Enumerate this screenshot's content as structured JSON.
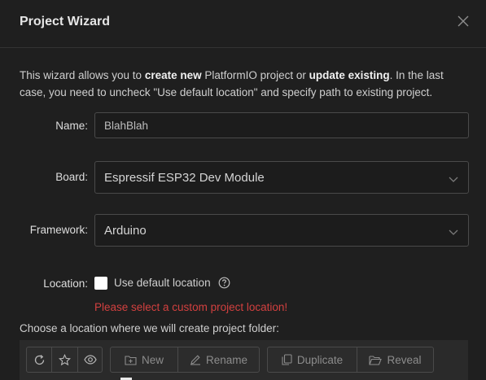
{
  "dialog": {
    "title": "Project Wizard",
    "intro": {
      "t1": "This wizard allows you to ",
      "b1": "create new",
      "t2": " PlatformIO project or ",
      "b2": "update existing",
      "t3": ". In the last case, you need to uncheck \"Use default location\" and specify path to existing project."
    }
  },
  "form": {
    "name_label": "Name",
    "name_value": "BlahBlah",
    "board_label": "Board",
    "board_value": "Espressif ESP32 Dev Module",
    "framework_label": "Framework",
    "framework_value": "Arduino",
    "location_label": "Location",
    "default_location_label": "Use default location",
    "default_location_checked": false,
    "error": "Please select a custom project location!",
    "choose_text": "Choose a location where we will create project folder:"
  },
  "toolbar": {
    "new_label": "New",
    "rename_label": "Rename",
    "duplicate_label": "Duplicate",
    "reveal_label": "Reveal"
  },
  "colors": {
    "background": "#1f1f1f",
    "error": "#d2403f",
    "border": "#4a4a4a"
  }
}
